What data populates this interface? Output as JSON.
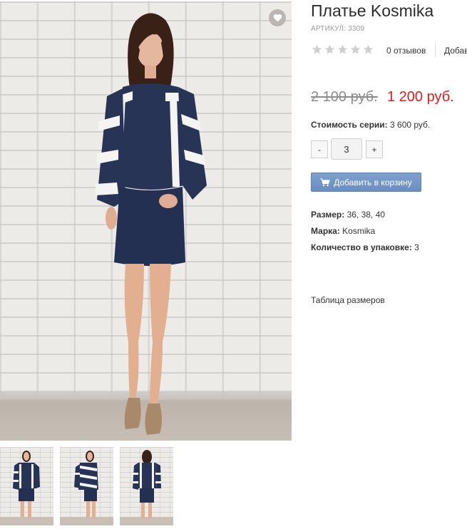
{
  "product": {
    "title": "Платье Kosmika",
    "sku": "АРТИКУЛ: 3309",
    "reviews_count": "0 отзывов",
    "add_review": "Добав",
    "old_price": "2 100 руб.",
    "new_price": "1 200 руб.",
    "series_label": "Стоимость серии:",
    "series_value": "3 600 руб.",
    "quantity": "3",
    "qty_minus": "-",
    "qty_plus": "+",
    "add_to_cart": "Добавить в корзину",
    "props": [
      {
        "label": "Размер:",
        "value": "36, 38, 40"
      },
      {
        "label": "Марка:",
        "value": "Kosmika"
      },
      {
        "label": "Количество в упаковке:",
        "value": "3"
      }
    ],
    "size_table_link": "Таблица размеров"
  },
  "rating": {
    "value": 0,
    "max": 5
  },
  "icons": {
    "wishlist": "heart-icon",
    "cart": "shopping-cart-icon",
    "star": "star-icon"
  },
  "colors": {
    "accent_button": "#7596c8",
    "sale_price": "#e21b1b",
    "star_empty": "#cfcfcf",
    "dress_navy": "#283456",
    "stripe_white": "#f4f4f2"
  }
}
